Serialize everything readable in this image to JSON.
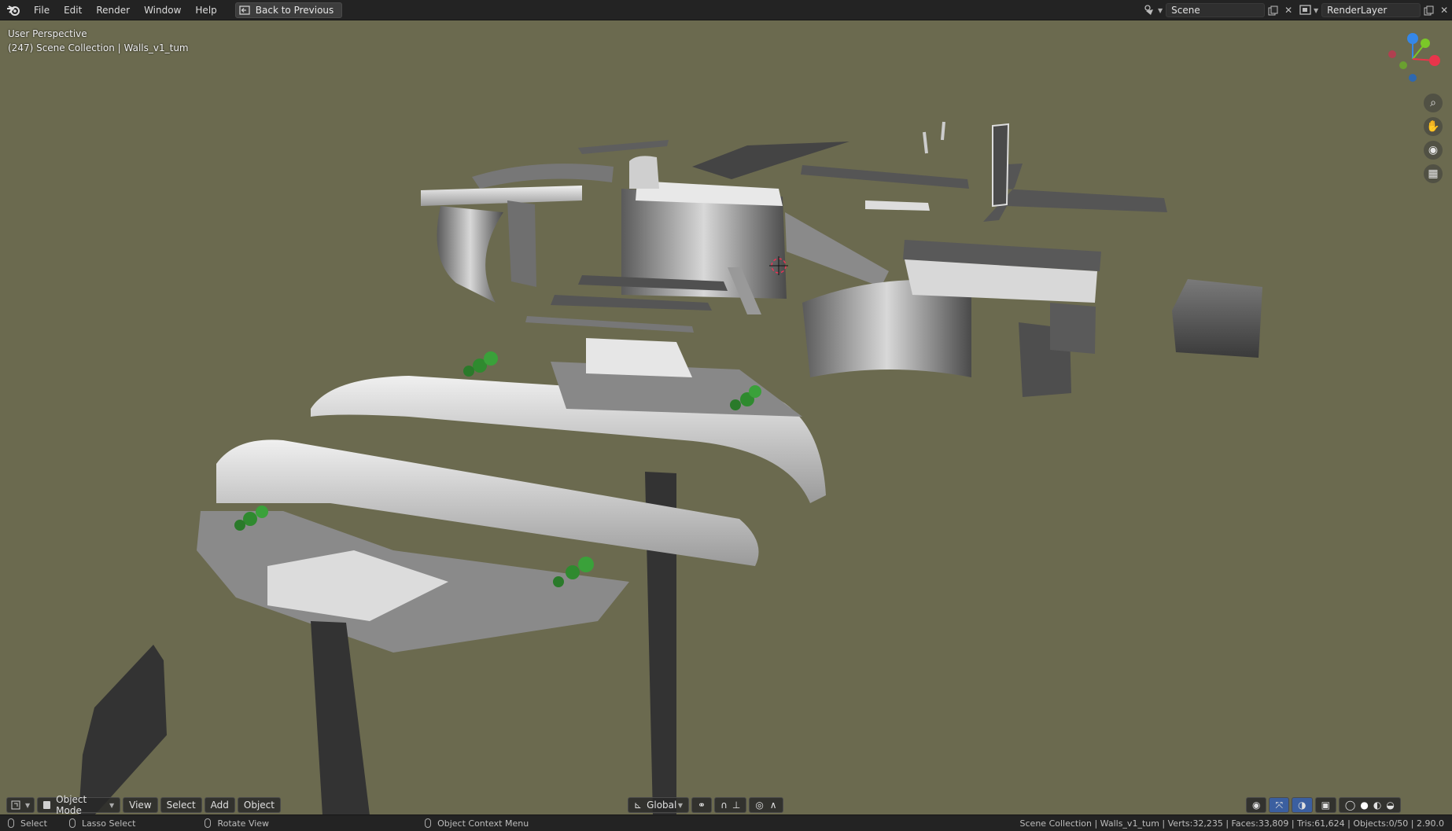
{
  "menu": {
    "items": [
      "File",
      "Edit",
      "Render",
      "Window",
      "Help"
    ],
    "back_button": "Back to Previous"
  },
  "scene_selector": {
    "value": "Scene"
  },
  "layer_selector": {
    "value": "RenderLayer"
  },
  "viewport": {
    "perspective_label": "User Perspective",
    "collection_label": "(247) Scene Collection | Walls_v1_tum",
    "background_color": "#6b6a4f"
  },
  "header": {
    "mode": "Object Mode",
    "view": "View",
    "select": "Select",
    "add": "Add",
    "object": "Object",
    "orientation": "Global"
  },
  "status": {
    "select": "Select",
    "lasso": "Lasso Select",
    "rotate": "Rotate View",
    "context": "Object Context Menu",
    "stats": "Scene Collection | Walls_v1_tum | Verts:32,235 | Faces:33,809 | Tris:61,624 | Objects:0/50 | 2.90.0"
  },
  "gizmo": {
    "x_color": "#e8354b",
    "y_color": "#7bc728",
    "z_color": "#3587e8"
  }
}
